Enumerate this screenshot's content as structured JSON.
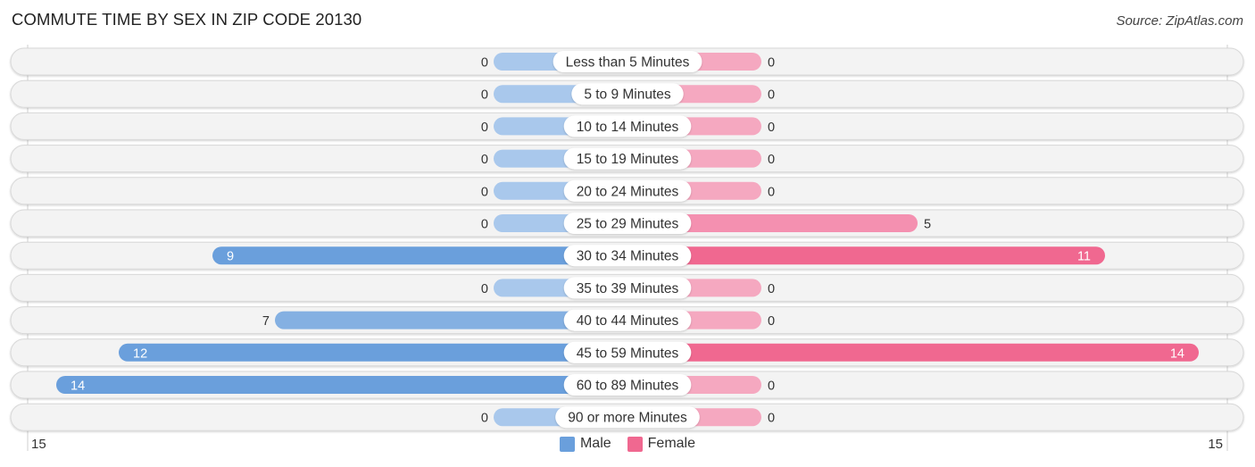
{
  "header": {
    "title": "COMMUTE TIME BY SEX IN ZIP CODE 20130",
    "source": "Source: ZipAtlas.com"
  },
  "colors": {
    "male": "#6a9fdc",
    "male_light": "#a9c8ec",
    "female": "#f06890",
    "female_light": "#f5a8c0",
    "row_bg": "#f3f3f3",
    "row_border": "#d8d8d8"
  },
  "legend": {
    "male": "Male",
    "female": "Female"
  },
  "axis": {
    "left_label": "15",
    "right_label": "15"
  },
  "chart_data": {
    "type": "bar",
    "orientation": "horizontal-diverging",
    "title": "COMMUTE TIME BY SEX IN ZIP CODE 20130",
    "categories": [
      "Less than 5 Minutes",
      "5 to 9 Minutes",
      "10 to 14 Minutes",
      "15 to 19 Minutes",
      "20 to 24 Minutes",
      "25 to 29 Minutes",
      "30 to 34 Minutes",
      "35 to 39 Minutes",
      "40 to 44 Minutes",
      "45 to 59 Minutes",
      "60 to 89 Minutes",
      "90 or more Minutes"
    ],
    "series": [
      {
        "name": "Male",
        "values": [
          0,
          0,
          0,
          0,
          0,
          0,
          9,
          0,
          7,
          12,
          14,
          0
        ]
      },
      {
        "name": "Female",
        "values": [
          0,
          0,
          0,
          0,
          0,
          5,
          11,
          0,
          0,
          14,
          0,
          0
        ]
      }
    ],
    "xlim": [
      -15,
      15
    ],
    "axis_tick_labels": [
      "15",
      "15"
    ],
    "legend_position": "bottom-center",
    "grid": false
  }
}
